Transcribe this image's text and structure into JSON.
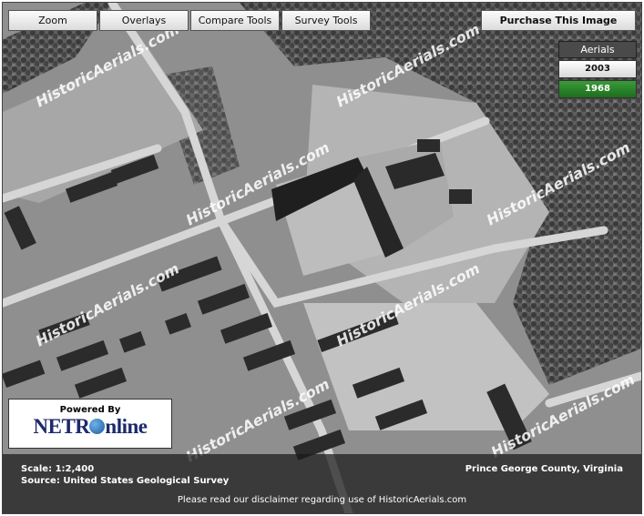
{
  "toolbar": {
    "zoom": "Zoom",
    "overlays": "Overlays",
    "compare": "Compare Tools",
    "survey": "Survey Tools"
  },
  "purchase": "Purchase This Image",
  "aerials": {
    "title": "Aerials",
    "years": [
      "2003",
      "1968"
    ],
    "selected": "1968"
  },
  "logo": {
    "powered_by": "Powered By",
    "net": "NETR",
    "online": "nline"
  },
  "watermark": "HistoricAerials.com",
  "info": {
    "scale": "Scale: 1:2,400",
    "source": "Source: United States Geological Survey",
    "county": "Prince George County, Virginia",
    "disclaimer": "Please read our disclaimer regarding use of HistoricAerials.com"
  },
  "colors": {
    "selected_year": "#1d6e1d",
    "info_bar": "#191919"
  }
}
